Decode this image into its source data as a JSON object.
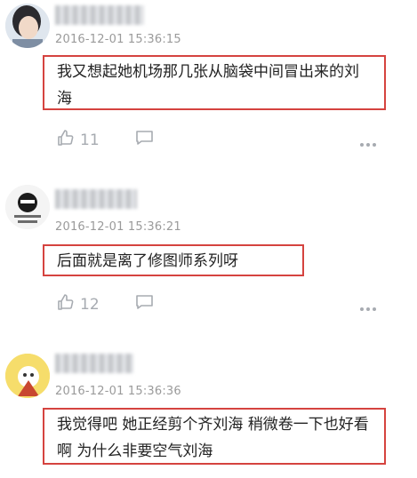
{
  "comments": [
    {
      "time": "2016-12-01 15:36:15",
      "text": "我又想起她机场那几张从脑袋中间冒出来的刘海",
      "likes": "11"
    },
    {
      "time": "2016-12-01 15:36:21",
      "text": "后面就是离了修图师系列呀",
      "likes": "12"
    },
    {
      "time": "2016-12-01 15:36:36",
      "text": "我觉得吧 她正经剪个齐刘海 稍微卷一下也好看啊 为什么非要空气刘海"
    }
  ],
  "icons": {
    "like": "thumbs-up-icon",
    "reply": "comment-bubble-icon",
    "more": "more-dots-icon"
  },
  "colors": {
    "highlight_box": "#d5433f",
    "timestamp": "#9a9a9a",
    "icon": "#a7abb1"
  }
}
